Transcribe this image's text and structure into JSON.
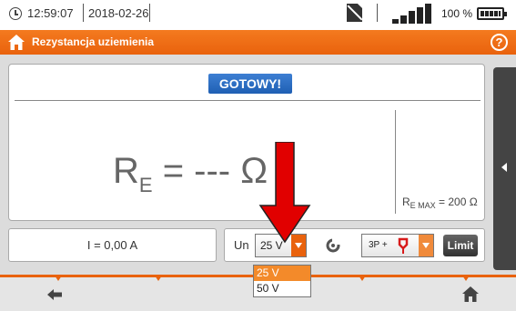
{
  "status_bar": {
    "time": "12:59:07",
    "date": "2018-02-26",
    "battery": "100 %"
  },
  "header": {
    "title": "Rezystancja uziemienia",
    "help": "?"
  },
  "result": {
    "status": "GOTOWY!",
    "main_symbol": "R",
    "main_sub": "E",
    "main_value": " = --- Ω",
    "limit_symbol": "R",
    "limit_sub": "E MAX",
    "limit_value": " = 200 Ω"
  },
  "measurement": {
    "current": "I = 0,00 A"
  },
  "controls": {
    "un_label": "Un",
    "un_selected": "25 V",
    "un_options": [
      "25 V",
      "50 V"
    ],
    "mode_selected": "3P +",
    "limit_button": "Limit"
  },
  "colors": {
    "accent": "#e9620d",
    "status_badge": "#2a6cc4",
    "annotation": "#e10000"
  }
}
